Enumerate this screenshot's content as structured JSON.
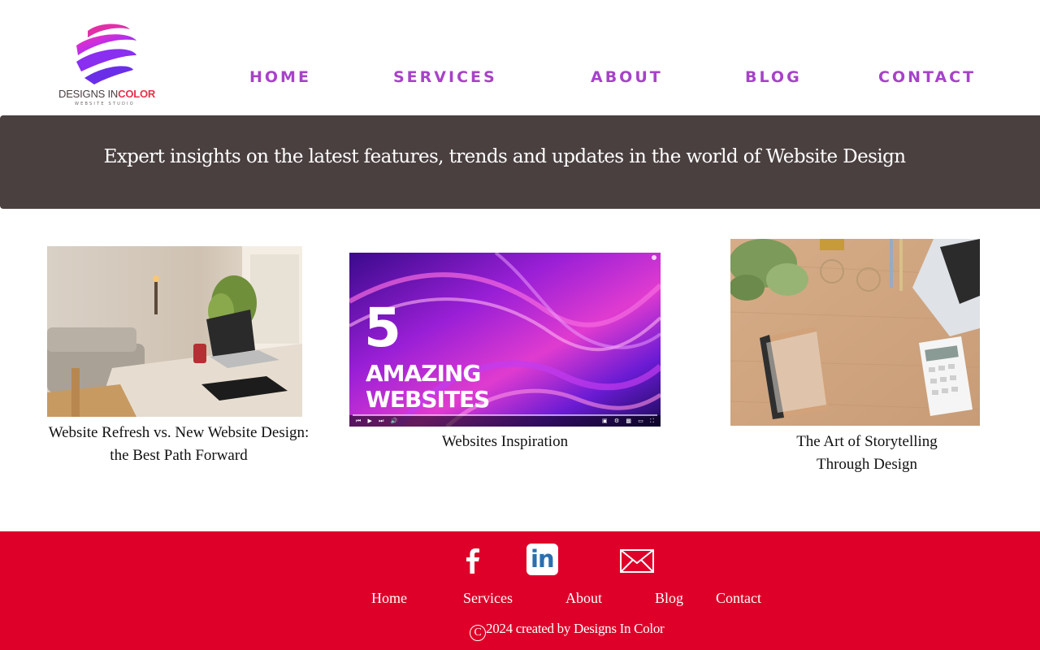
{
  "brand": {
    "logo_main": "DESIGNS IN",
    "logo_accent": "COLOR",
    "logo_sub": "WEBSITE STUDIO",
    "colors": {
      "pink": "#e22fa8",
      "purple": "#6a2ee8",
      "accent": "#e7304a"
    }
  },
  "nav": {
    "items": [
      {
        "label": "HOME"
      },
      {
        "label": "SERVICES"
      },
      {
        "label": "ABOUT"
      },
      {
        "label": "BLOG"
      },
      {
        "label": "CONTACT"
      }
    ],
    "color": "#a743c8"
  },
  "banner": {
    "text": "Expert insights on the latest features, trends and updates in the world of Website Design",
    "background": "#4b4040"
  },
  "posts": [
    {
      "title_line1": "Website Refresh vs. New Website Design:",
      "title_line2": "the Best Path Forward"
    },
    {
      "title_line1": "Websites Inspiration",
      "image_number": "5",
      "image_line1": "AMAZING",
      "image_line2": "WEBSITES"
    },
    {
      "title_line1": "The Art of Storytelling",
      "title_line2": "Through Design"
    }
  ],
  "footer": {
    "background": "#df0029",
    "social": [
      {
        "icon": "facebook-icon"
      },
      {
        "icon": "linkedin-icon",
        "label": "in"
      },
      {
        "icon": "email-icon"
      }
    ],
    "links": [
      {
        "label": "Home"
      },
      {
        "label": "Services"
      },
      {
        "label": "About"
      },
      {
        "label": "Blog"
      },
      {
        "label": "Contact"
      }
    ],
    "copyright_symbol": "C",
    "copyright_text": "2024 created by Designs In Color"
  }
}
